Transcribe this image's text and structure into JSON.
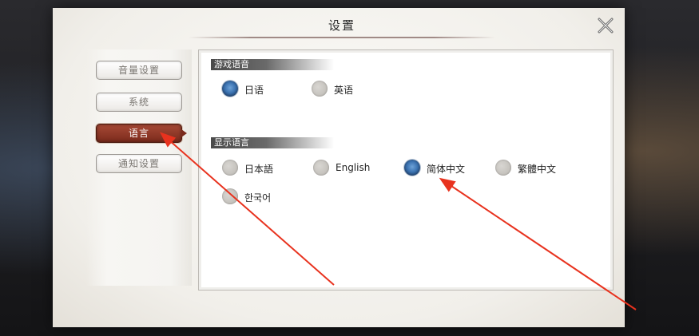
{
  "dialog": {
    "title": "设置"
  },
  "nav": {
    "items": [
      {
        "label": "音量设置",
        "active": false
      },
      {
        "label": "系统",
        "active": false
      },
      {
        "label": "语言",
        "active": true
      },
      {
        "label": "通知设置",
        "active": false
      }
    ]
  },
  "voice_language": {
    "header": "游戏语音",
    "options": [
      {
        "label": "日语",
        "selected": true
      },
      {
        "label": "英语",
        "selected": false
      }
    ]
  },
  "display_language": {
    "header": "显示语言",
    "options": [
      {
        "label": "日本語",
        "selected": false
      },
      {
        "label": "English",
        "selected": false
      },
      {
        "label": "简体中文",
        "selected": true
      },
      {
        "label": "繁體中文",
        "selected": false
      },
      {
        "label": "한국어",
        "selected": false
      }
    ]
  },
  "colors": {
    "accent_active": "#8a3424",
    "radio_selected": "#3b72b0",
    "annotation_arrow": "#e8321e"
  },
  "icons": {
    "close": "close-x-icon"
  }
}
